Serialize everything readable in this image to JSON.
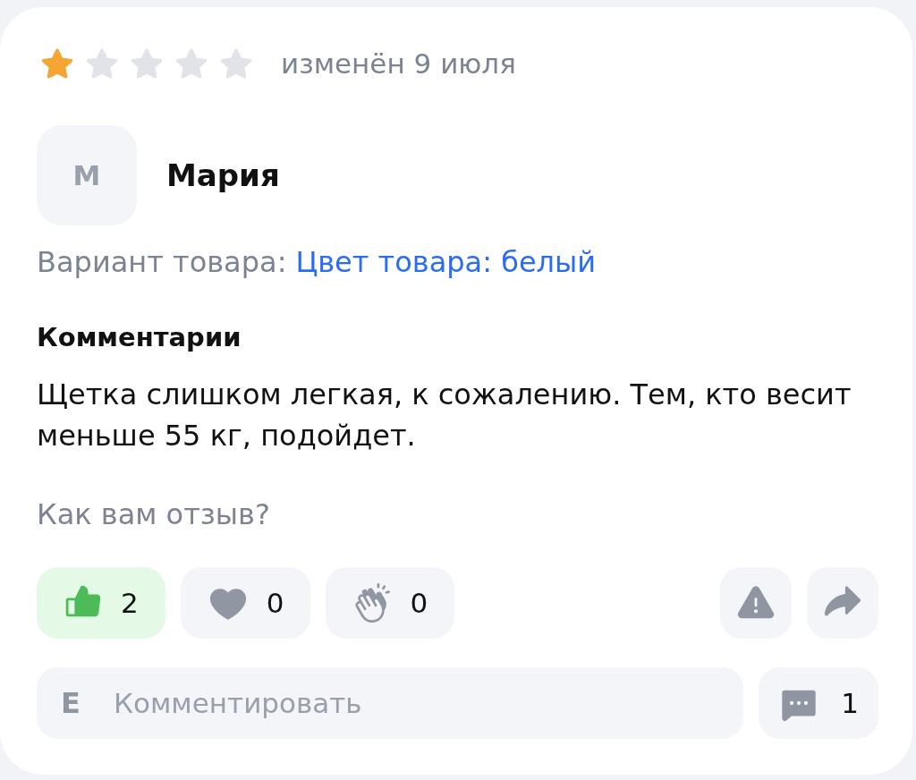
{
  "review": {
    "stars": 1,
    "date": "изменён 9 июля"
  },
  "author": {
    "initial": "М",
    "name": "Мария"
  },
  "variant": {
    "label": "Вариант товара:",
    "value": "Цвет товара: белый"
  },
  "comments_heading": "Комментарии",
  "text": "Щетка слишком легкая, к сожалению. Тем, кто весит меньше 55 кг, подойдет.",
  "prompt": "Как вам отзыв?",
  "reactions": [
    {
      "kind": "like",
      "count": "2",
      "selected": true
    },
    {
      "kind": "heart",
      "count": "0",
      "selected": false
    },
    {
      "kind": "clap",
      "count": "0",
      "selected": false
    }
  ],
  "actions": [
    {
      "kind": "report"
    },
    {
      "kind": "share"
    }
  ],
  "comment_box": {
    "user_initial": "Е",
    "placeholder": "Комментировать"
  },
  "comment_count": "1"
}
